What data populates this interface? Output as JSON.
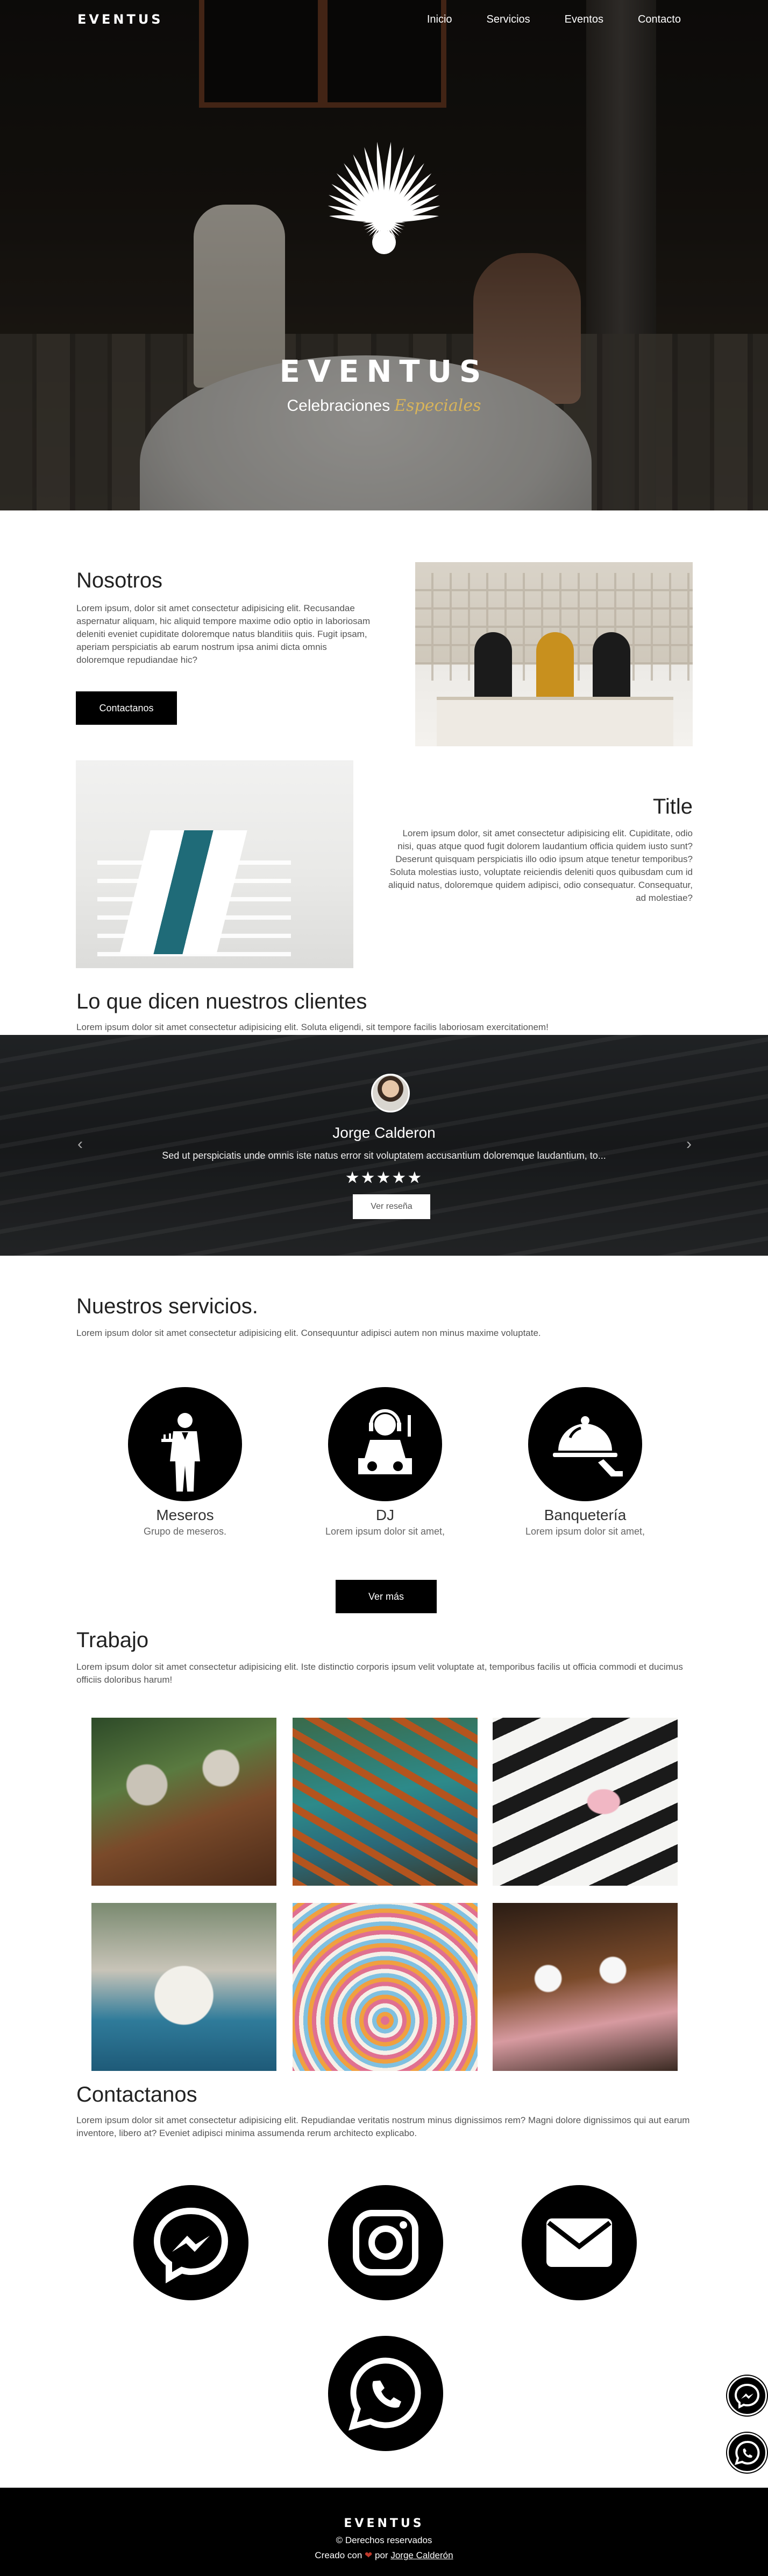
{
  "nav": {
    "brand": "EVENTUS",
    "links": [
      "Inicio",
      "Servicios",
      "Eventos",
      "Contacto"
    ]
  },
  "hero": {
    "title": "EVENTUS",
    "subtitle": "Celebraciones",
    "subtitle_accent": "Especiales"
  },
  "about": {
    "title": "Nosotros",
    "text": "Lorem ipsum, dolor sit amet consectetur adipisicing elit. Recusandae aspernatur aliquam, hic aliquid tempore maxime odio optio in laboriosam deleniti eveniet cupiditate doloremque natus blanditiis quis. Fugit ipsam, aperiam perspiciatis ab earum nostrum ipsa animi dicta omnis doloremque repudiandae hic?",
    "button": "Contactanos"
  },
  "feature": {
    "title": "Title",
    "text": "Lorem ipsum dolor, sit amet consectetur adipisicing elit. Cupiditate, odio nisi, quas atque quod fugit dolorem laudantium officia quidem iusto sunt? Deserunt quisquam perspiciatis illo odio ipsum atque tenetur temporibus? Soluta molestias iusto, voluptate reiciendis deleniti quos quibusdam cum id aliquid natus, doloremque quidem adipisci, odio consequatur. Consequatur, ad molestiae?"
  },
  "testimonials": {
    "title": "Lo que dicen nuestros clientes",
    "subtitle": "Lorem ipsum dolor sit amet consectetur adipisicing elit. Soluta eligendi, sit tempore facilis laboriosam exercitationem!",
    "name": "Jorge Calderon",
    "quote": "Sed ut perspiciatis unde omnis iste natus error sit voluptatem accusantium doloremque laudantium, to...",
    "stars": "★★★★★",
    "rating": 5,
    "button": "Ver reseña",
    "prev": "‹",
    "next": "›"
  },
  "services": {
    "title": "Nuestros servicios.",
    "subtitle": "Lorem ipsum dolor sit amet consectetur adipisicing elit. Consequuntur adipisci autem non minus maxime voluptate.",
    "items": [
      {
        "name": "Meseros",
        "desc": "Grupo de meseros.",
        "icon": "waiter-icon"
      },
      {
        "name": "DJ",
        "desc": "Lorem ipsum dolor sit amet,",
        "icon": "dj-icon"
      },
      {
        "name": "Banquetería",
        "desc": "Lorem ipsum dolor sit amet,",
        "icon": "catering-cloche-icon"
      }
    ],
    "button": "Ver más"
  },
  "work": {
    "title": "Trabajo",
    "subtitle": "Lorem ipsum dolor sit amet consectetur adipisicing elit. Iste distinctio corporis ipsum velit voluptate at, temporibus facilis ut officia commodi et ducimus officiis doloribus harum!"
  },
  "contact": {
    "title": "Contactanos",
    "subtitle": "Lorem ipsum dolor sit amet consectetur adipisicing elit. Repudiandae veritatis nostrum minus dignissimos rem? Magni dolore dignissimos qui aut earum inventore, libero at? Eveniet adipisci minima assumenda rerum architecto explicabo.",
    "channels": [
      "messenger-icon",
      "instagram-icon",
      "mail-icon",
      "whatsapp-icon"
    ]
  },
  "footer": {
    "brand": "EVENTUS",
    "rights": "© Derechos reservados",
    "credit_prefix": "Creado con",
    "credit_by": "por",
    "author": "Jorge Calderón"
  },
  "colors": {
    "accent_gold": "#d8b45a",
    "footer_bg": "#000000",
    "heart": "#c0392b"
  }
}
